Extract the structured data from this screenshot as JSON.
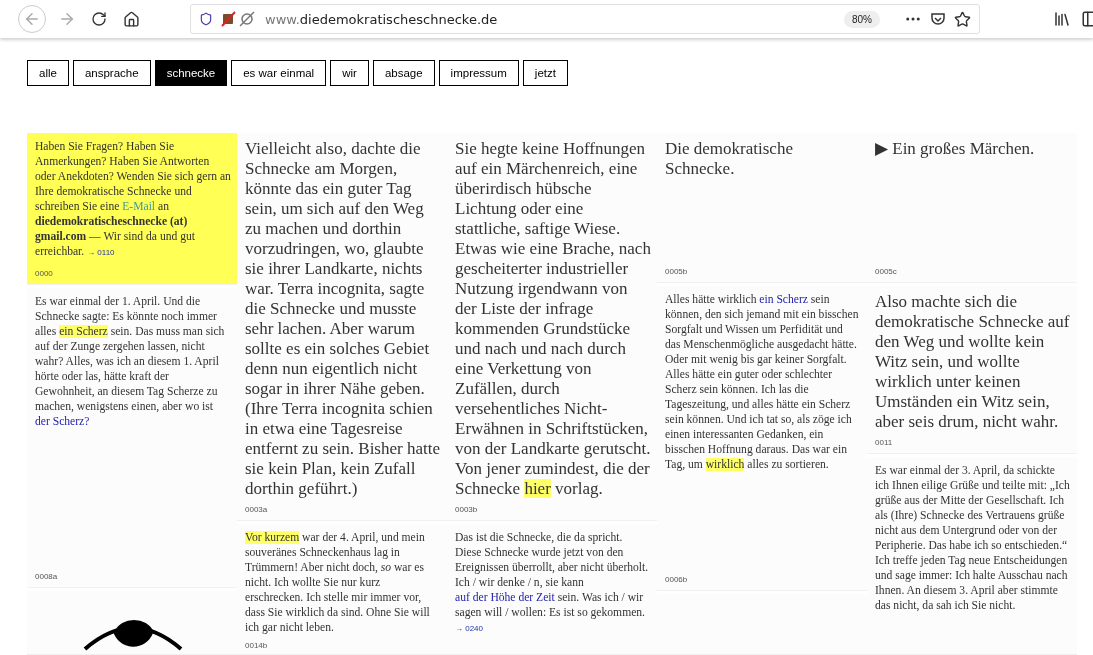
{
  "browser": {
    "url_prefix": "www.",
    "url_domain": "diedemokratischeschnecke.de",
    "zoom": "80%"
  },
  "nav": [
    {
      "label": "alle",
      "selected": false
    },
    {
      "label": "ansprache",
      "selected": false
    },
    {
      "label": "schnecke",
      "selected": true
    },
    {
      "label": "es war einmal",
      "selected": false
    },
    {
      "label": "wir",
      "selected": false
    },
    {
      "label": "absage",
      "selected": false
    },
    {
      "label": "impressum",
      "selected": false
    },
    {
      "label": "jetzt",
      "selected": false
    }
  ],
  "columns": [
    {
      "cards": [
        {
          "kind": "small-text",
          "highlighted": true,
          "id": "0000",
          "segments": [
            {
              "kind": "plain",
              "text": "Haben Sie Fragen? Haben Sie Anmerkungen? Haben Sie Antworten oder Anekdoten? Wenden Sie sich gern an Ihre demokratische Schnecke und schreiben Sie eine "
            },
            {
              "kind": "link",
              "text": "E-Mail"
            },
            {
              "kind": "plain",
              "text": " an "
            },
            {
              "kind": "bold",
              "text": "diedemokratischeschnecke (at) gmail.com"
            },
            {
              "kind": "plain",
              "text": " — Wir sind da und gut erreichbar. "
            },
            {
              "kind": "ref",
              "text": "→ 0110"
            }
          ]
        },
        {
          "kind": "small-text",
          "highlighted": false,
          "id": "0008a",
          "segments": [
            {
              "kind": "plain",
              "text": "Es war einmal der 1. April. Und die Schnecke sagte: Es könnte noch immer alles "
            },
            {
              "kind": "mark",
              "text": "ein Scherz"
            },
            {
              "kind": "plain",
              "text": " sein. Das muss man sich auf der Zunge zergehen lassen, nicht wahr? Alles, was ich an diesem 1. April hörte oder las, hätte kraft der Gewohnheit, an diesem Tag Scherze zu machen, wenigstens einen, aber wo ist "
            },
            {
              "kind": "link",
              "text": "der Scherz?"
            }
          ]
        },
        {
          "kind": "drawing",
          "highlighted": false
        }
      ]
    },
    {
      "cards": [
        {
          "kind": "large-text",
          "highlighted": false,
          "id": "0003a",
          "segments": [
            {
              "kind": "plain",
              "text": "Vielleicht also, dachte die Schnecke am Morgen, könnte das ein guter Tag sein, um sich auf den Weg zu machen und dorthin vorzudringen, wo, glaubte sie ihrer Landkarte, nichts war. Terra incognita, sagte die Schnecke und musste sehr lachen. Aber warum sollte es ein solches Gebiet denn nun eigentlich nicht sogar in ihrer Nähe geben. (Ihre Terra incognita schien in etwa eine Tagesreise entfernt zu sein. Bisher hatte sie kein Plan, kein Zufall dorthin geführt.)"
            }
          ]
        },
        {
          "kind": "small-text",
          "highlighted": false,
          "id": "0014b",
          "segments": [
            {
              "kind": "mark",
              "text": "Vor kurzem"
            },
            {
              "kind": "plain",
              "text": " war der 4. April, und mein souveränes Schneckenhaus lag in Trümmern! Aber nicht doch, "
            },
            {
              "kind": "italic",
              "text": "so"
            },
            {
              "kind": "plain",
              "text": " war es nicht. Ich wollte Sie nur kurz erschrecken. Ich stelle mir immer vor, dass Sie wirklich da sind. Ohne Sie will ich gar nicht leben."
            }
          ]
        }
      ]
    },
    {
      "cards": [
        {
          "kind": "large-text",
          "highlighted": false,
          "id": "0003b",
          "segments": [
            {
              "kind": "plain",
              "text": "Sie hegte keine Hoffnungen auf ein Märchenreich, eine überirdisch hübsche Lichtung oder eine stattliche, saftige Wiese. Etwas wie eine Brache, nach gescheiterter industrieller Nutzung irgendwann von der Liste der infrage kommenden Grundstücke und nach und nach durch eine Verkettung von Zufällen, durch versehentliches Nicht-Erwähnen in Schriftstücken, von der Landkarte gerutscht. Von jener zumindest, die der Schnecke "
            },
            {
              "kind": "mark",
              "text": "hier"
            },
            {
              "kind": "plain",
              "text": " vorlag."
            }
          ]
        },
        {
          "kind": "small-text",
          "highlighted": false,
          "segments": [
            {
              "kind": "plain",
              "text": "Das ist die Schnecke, die da spricht. Diese Schnecke wurde jetzt von den Ereignissen überrollt, aber nicht überholt. Ich / wir denke / n, sie kann "
            },
            {
              "kind": "link",
              "text": "auf der Höhe der Zeit"
            },
            {
              "kind": "plain",
              "text": " sein. Was ich / wir sagen will / wollen: Es ist so gekommen. "
            },
            {
              "kind": "ref",
              "text": "→ 0240"
            }
          ]
        }
      ]
    },
    {
      "cards": [
        {
          "kind": "large-text",
          "highlighted": false,
          "id": "0005b",
          "segments": [
            {
              "kind": "plain",
              "text": "Die demokratische Schnecke."
            }
          ]
        },
        {
          "kind": "small-text",
          "highlighted": false,
          "id": "0006b",
          "segments": [
            {
              "kind": "plain",
              "text": "Alles hätte wirklich "
            },
            {
              "kind": "link",
              "text": "ein Scherz"
            },
            {
              "kind": "plain",
              "text": " sein können, den sich jemand mit ein bisschen Sorgfalt und Wissen um Perfidität und das Menschenmögliche ausgedacht hätte. Oder mit wenig bis gar keiner Sorgfalt. Alles hätte ein guter oder schlechter Scherz sein können. Ich las die Tageszeitung, und alles hätte ein Scherz sein können. Und ich tat so, als zöge ich einen interessanten Gedanken, ein bisschen Hoffnung daraus. Das war ein Tag, um "
            },
            {
              "kind": "mark",
              "text": "wirklich"
            },
            {
              "kind": "plain",
              "text": " alles zu sortieren."
            }
          ]
        },
        {
          "kind": "empty",
          "highlighted": false
        }
      ]
    },
    {
      "cards": [
        {
          "kind": "large-text",
          "highlighted": false,
          "id": "0005c",
          "segments": [
            {
              "kind": "plain",
              "text": "▶ Ein großes Märchen."
            }
          ]
        },
        {
          "kind": "large-text",
          "highlighted": false,
          "id": "0011",
          "segments": [
            {
              "kind": "plain",
              "text": "Also machte sich die demokratische Schnecke auf den Weg und wollte kein Witz sein, und wollte wirklich unter keinen Umständen ein Witz sein, aber seis drum, nicht wahr."
            }
          ]
        },
        {
          "kind": "small-text",
          "highlighted": false,
          "segments": [
            {
              "kind": "plain",
              "text": "Es war einmal der 3. April, da schickte ich Ihnen eilige Grüße und teilte mit: „Ich grüße aus der Mitte der Gesellschaft. Ich als (Ihre) Schnecke des Vertrauens grüße nicht aus dem Untergrund oder von der Peripherie. Das habe ich so entschieden.“ Ich treffe jeden Tag neue Entscheidungen und sage immer: Ich halte Ausschau nach Ihnen. An diesem 3. April aber stimmte das nicht, da sah ich Sie nicht."
            }
          ]
        }
      ]
    }
  ]
}
